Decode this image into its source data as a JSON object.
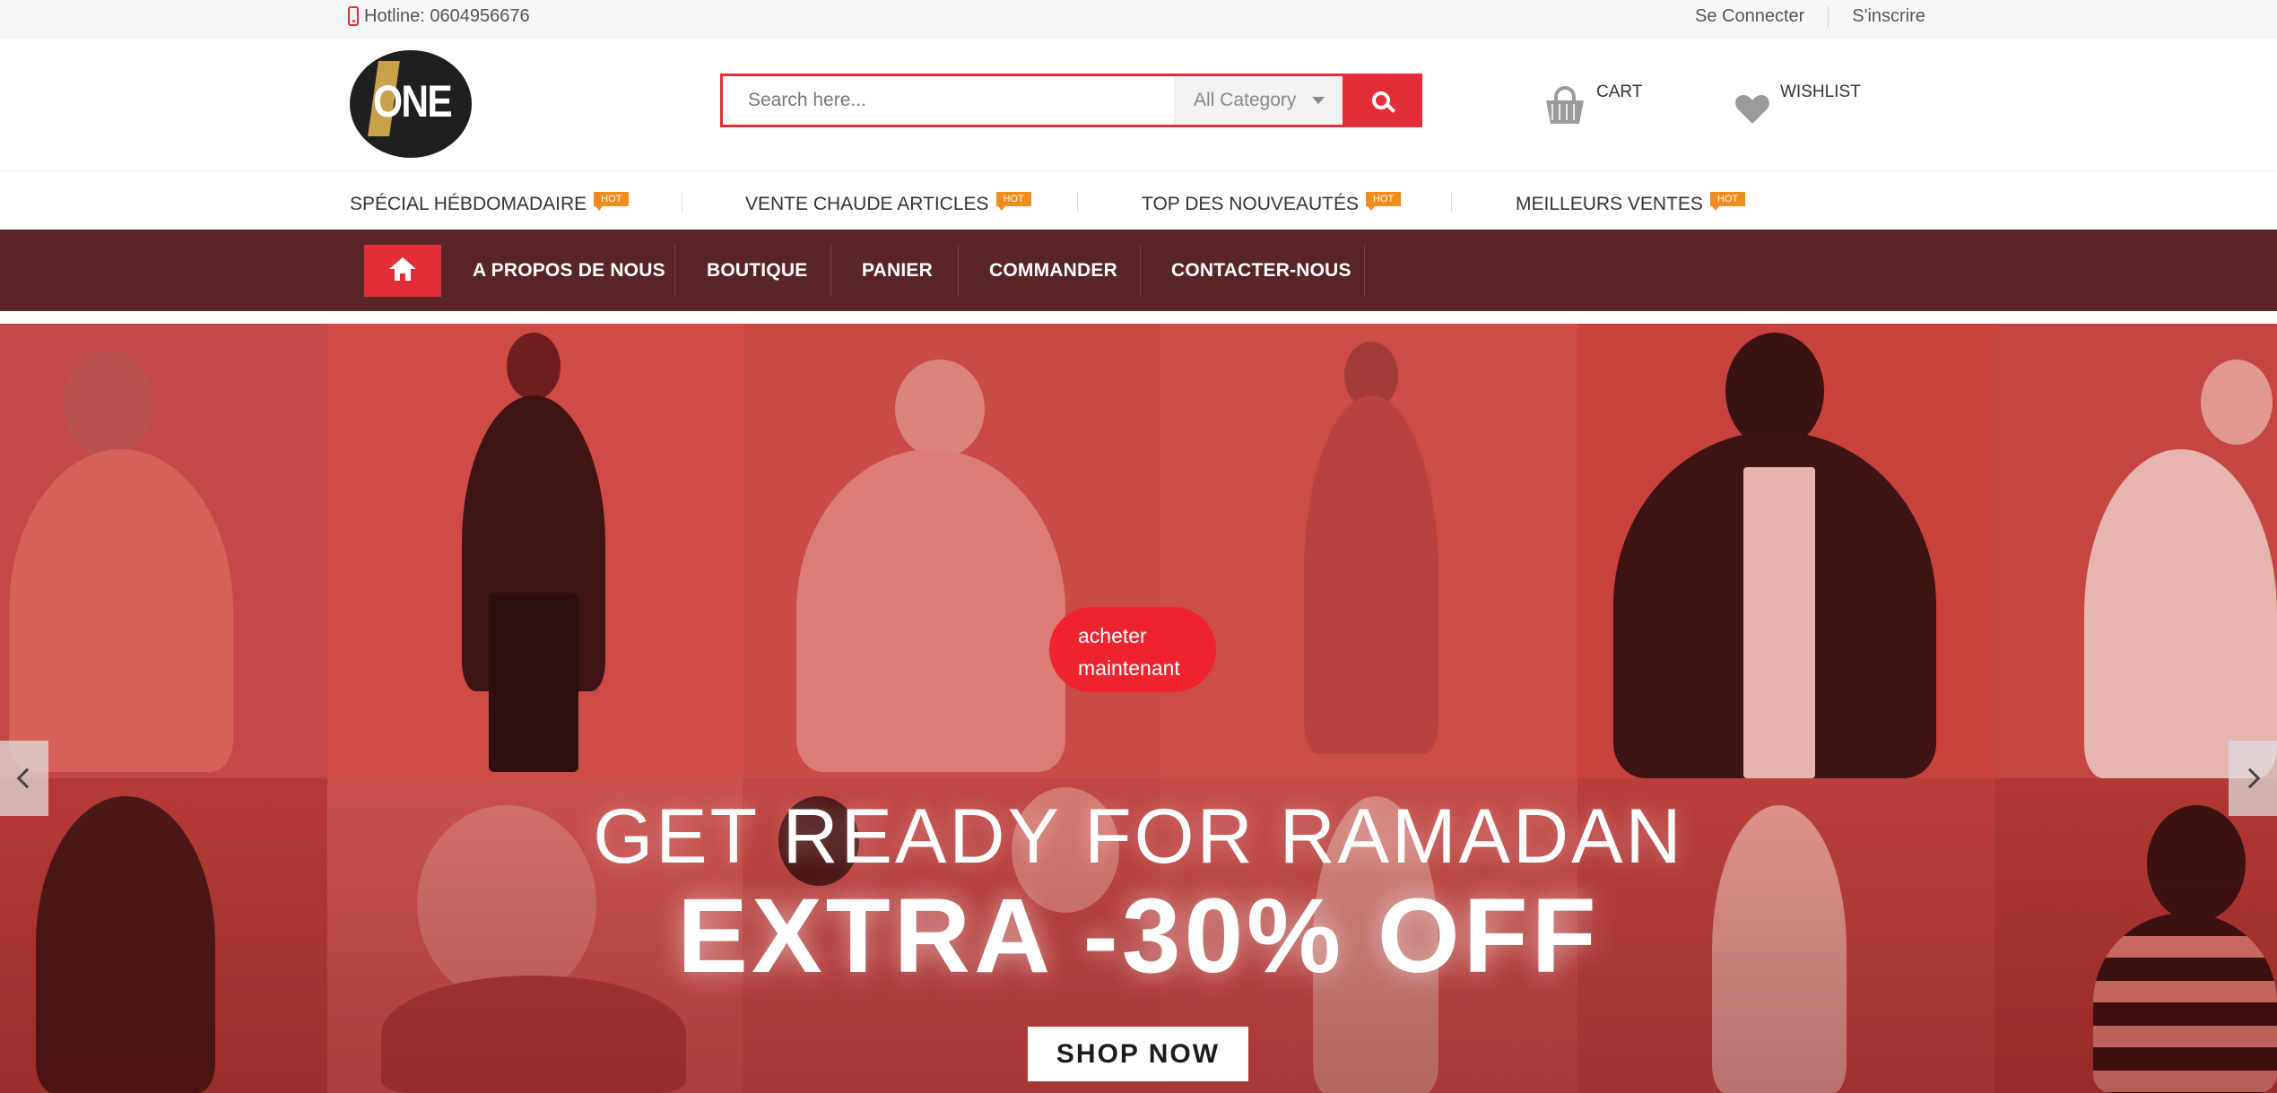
{
  "topbar": {
    "hotline": "Hotline: 0604956676",
    "login": "Se Connecter",
    "signup": "S'inscrire"
  },
  "logo": {
    "text": "ONE"
  },
  "search": {
    "placeholder": "Search here...",
    "category": "All Category"
  },
  "header": {
    "cart_label": "CART",
    "wishlist_label": "WISHLIST"
  },
  "strip": {
    "items": [
      {
        "label": "SPÉCIAL HÉBDOMADAIRE",
        "badge": "HOT"
      },
      {
        "label": "VENTE CHAUDE ARTICLES",
        "badge": "HOT"
      },
      {
        "label": "TOP DES NOUVEAUTÉS",
        "badge": "HOT"
      },
      {
        "label": "MEILLEURS VENTES",
        "badge": "HOT"
      }
    ]
  },
  "nav": {
    "items": [
      {
        "label": "A PROPOS DE NOUS"
      },
      {
        "label": "BOUTIQUE"
      },
      {
        "label": "PANIER"
      },
      {
        "label": "COMMANDER"
      },
      {
        "label": "CONTACTER-NOUS"
      }
    ]
  },
  "hero": {
    "buy_line1": "acheter",
    "buy_line2": "maintenant",
    "headline": "GET READY FOR RAMADAN",
    "subline": "EXTRA -30% OFF",
    "shop_now": "SHOP NOW"
  },
  "colors": {
    "accent": "#e52d3a",
    "nav_bg": "#5a2528",
    "hot_badge": "#f08c1c",
    "hero_bg": "#c6423f"
  }
}
